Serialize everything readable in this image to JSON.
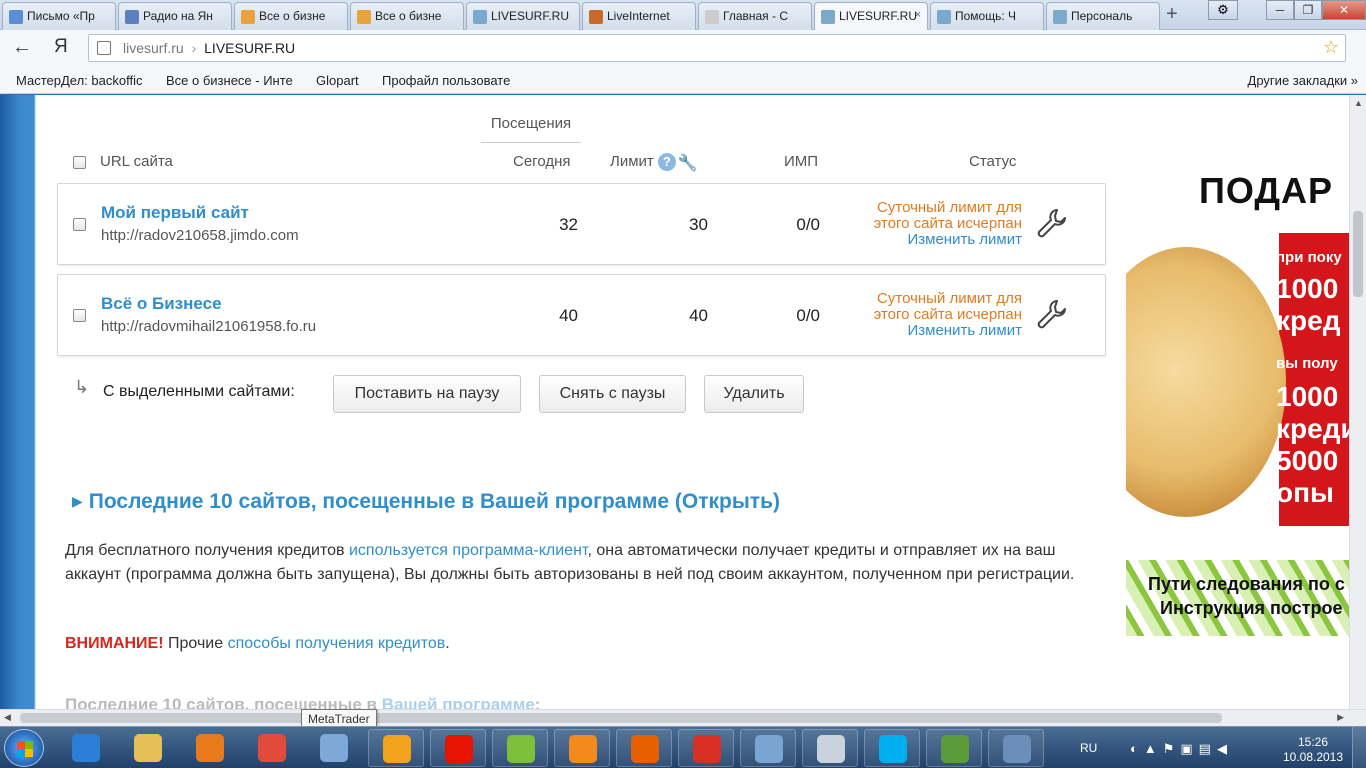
{
  "browser": {
    "tabs": [
      {
        "label": "Письмо «Пр",
        "fav": "#5a8fd6"
      },
      {
        "label": "Радио на Ян",
        "fav": "#5c7fbf"
      },
      {
        "label": "Все о бизне",
        "fav": "#e8a33a"
      },
      {
        "label": "Все о бизне",
        "fav": "#e8a33a"
      },
      {
        "label": "LIVESURF.RU",
        "fav": "#7aa9c9"
      },
      {
        "label": "LiveInternet",
        "fav": "#c86b2a"
      },
      {
        "label": "Главная - С",
        "fav": "#cccccc"
      },
      {
        "label": "LIVESURF.RU",
        "fav": "#7aa9c9",
        "active": true
      },
      {
        "label": "Помощь: Ч",
        "fav": "#7aa9c9"
      },
      {
        "label": "Персональ",
        "fav": "#7aa9c9"
      }
    ],
    "tab_close": "×",
    "new_tab": "+",
    "address": {
      "host": "livesurf.ru",
      "separator": "›",
      "title": "LIVESURF.RU"
    },
    "bookmarks": [
      "МастерДел: backoffic",
      "Все о бизнесе - Инте",
      "Glopart",
      "Профайл пользовате"
    ],
    "other_bookmarks": "Другие закладки »",
    "back_icon": "←",
    "yandex_logo": "Я"
  },
  "table": {
    "header_visits": "Посещения",
    "col_url": "URL сайта",
    "col_today": "Сегодня",
    "col_limit": "Лимит",
    "col_imp": "ИМП",
    "col_status": "Статус",
    "help": "?",
    "rows": [
      {
        "name": "Мой первый сайт",
        "url": "http://radov210658.jimdo.com",
        "today": "32",
        "limit": "30",
        "imp": "0/0",
        "status_line1": "Суточный лимит для",
        "status_line2": "этого сайта исчерпан",
        "change_limit": "Изменить лимит"
      },
      {
        "name": "Всё о Бизнесе",
        "url": "http://radovmihail21061958.fo.ru",
        "today": "40",
        "limit": "40",
        "imp": "0/0",
        "status_line1": "Суточный лимит для",
        "status_line2": "этого сайта исчерпан",
        "change_limit": "Изменить лимит"
      }
    ]
  },
  "bulk": {
    "label": "С выделенными сайтами:",
    "pause": "Поставить на паузу",
    "unpause": "Снять с паузы",
    "delete": "Удалить"
  },
  "section": {
    "title": "Последние 10 сайтов, посещенные в Вашей программе (Открыть)",
    "para_1": "Для бесплатного получения кредитов ",
    "para_link": "используется программа-клиент",
    "para_2": ", она автоматически получает кредиты и отправляет их на ваш аккаунт (программа должна быть запущена), Вы должны быть авторизованы в ней под своим аккаунтом, полученном при регистрации.",
    "warn_bold": "ВНИМАНИЕ!",
    "warn_text": " Прочие ",
    "warn_link": "способы получения кредитов",
    "warn_end": ".",
    "faded_1": "Последние 10 сайтов, посещенные в ",
    "faded_link": "Вашей программе",
    "faded_end": ":"
  },
  "ads": {
    "banner1_headline": "ПОДАР",
    "banner1_red": [
      "при поку",
      "1000",
      "кред",
      "вы полу",
      "1000",
      "креди",
      "5000",
      "опы"
    ],
    "banner2_line1": "Пути следования по с",
    "banner2_line2": "Инструкция построе"
  },
  "tooltip": "MetaTrader",
  "taskbar": {
    "lang": "RU",
    "time": "15:26",
    "date": "10.08.2013",
    "items": [
      {
        "name": "ie",
        "color": "#2b7fd6"
      },
      {
        "name": "explorer",
        "color": "#e6c056"
      },
      {
        "name": "media",
        "color": "#e87a1c"
      },
      {
        "name": "chrome",
        "color": "#e24a3a"
      },
      {
        "name": "contacts",
        "color": "#7ea8d8"
      },
      {
        "name": "mail-at",
        "color": "#f2a21b"
      },
      {
        "name": "yandex",
        "color": "#e61400"
      },
      {
        "name": "ball",
        "color": "#7bbf3a"
      },
      {
        "name": "odnoklassniki",
        "color": "#f38b1c"
      },
      {
        "name": "firefox",
        "color": "#e66000"
      },
      {
        "name": "yandex2",
        "color": "#d93025"
      },
      {
        "name": "speaker",
        "color": "#7aa4d2"
      },
      {
        "name": "calculator",
        "color": "#c9d3de"
      },
      {
        "name": "skype",
        "color": "#00aff0"
      },
      {
        "name": "chart-app",
        "color": "#5b9b3a"
      },
      {
        "name": "network",
        "color": "#6b8fb8"
      }
    ]
  }
}
